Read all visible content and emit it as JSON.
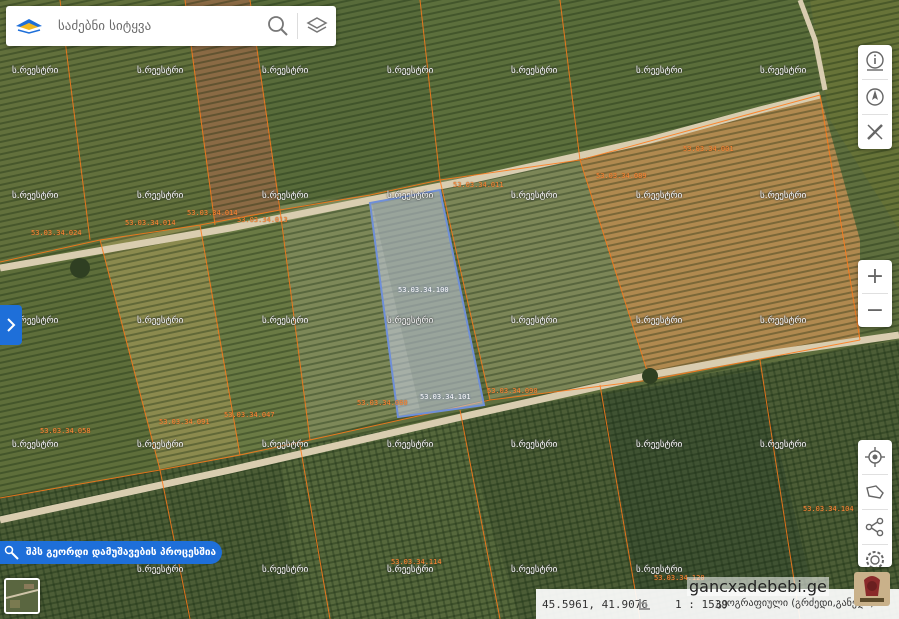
{
  "search": {
    "placeholder": "საძებნი სიტყვა"
  },
  "watermark_text": "ს.რეესტრი",
  "parcel_ids": {
    "p1": "53.03.34.001",
    "p2": "53.03.34.011",
    "p3": "53.03.34.013",
    "p4": "53.03.34.089",
    "p5": "53.03.34.014",
    "p6": "53.03.34.100",
    "p7": "53.03.34.101",
    "p8": "53.03.34.090",
    "p9": "53.03.34.080",
    "p10": "53.03.34.047",
    "p11": "53.03.34.014",
    "p12": "53.03.34.024",
    "p13": "53.03.34.091",
    "p14": "53.03.34.058",
    "p15": "53.03.34.104",
    "p16": "53.03.34.114",
    "p17": "53.03.34.120"
  },
  "process_button": {
    "label": "შპს გეორდი დამუშავების პროცესშია"
  },
  "status_bar": {
    "coords": "45.5961, 41.9076",
    "scale": "1 : 1539",
    "crs": "გეოგრაფიული (გრძედი,განედი)"
  },
  "site_watermark": "gancxadebebi.ge",
  "controls": {
    "zoom_in": "+",
    "zoom_out": "−"
  },
  "colors": {
    "accent": "#1e6fd9",
    "parcel_border": "#ff7a1a",
    "selected_fill": "#c8d0e8"
  }
}
